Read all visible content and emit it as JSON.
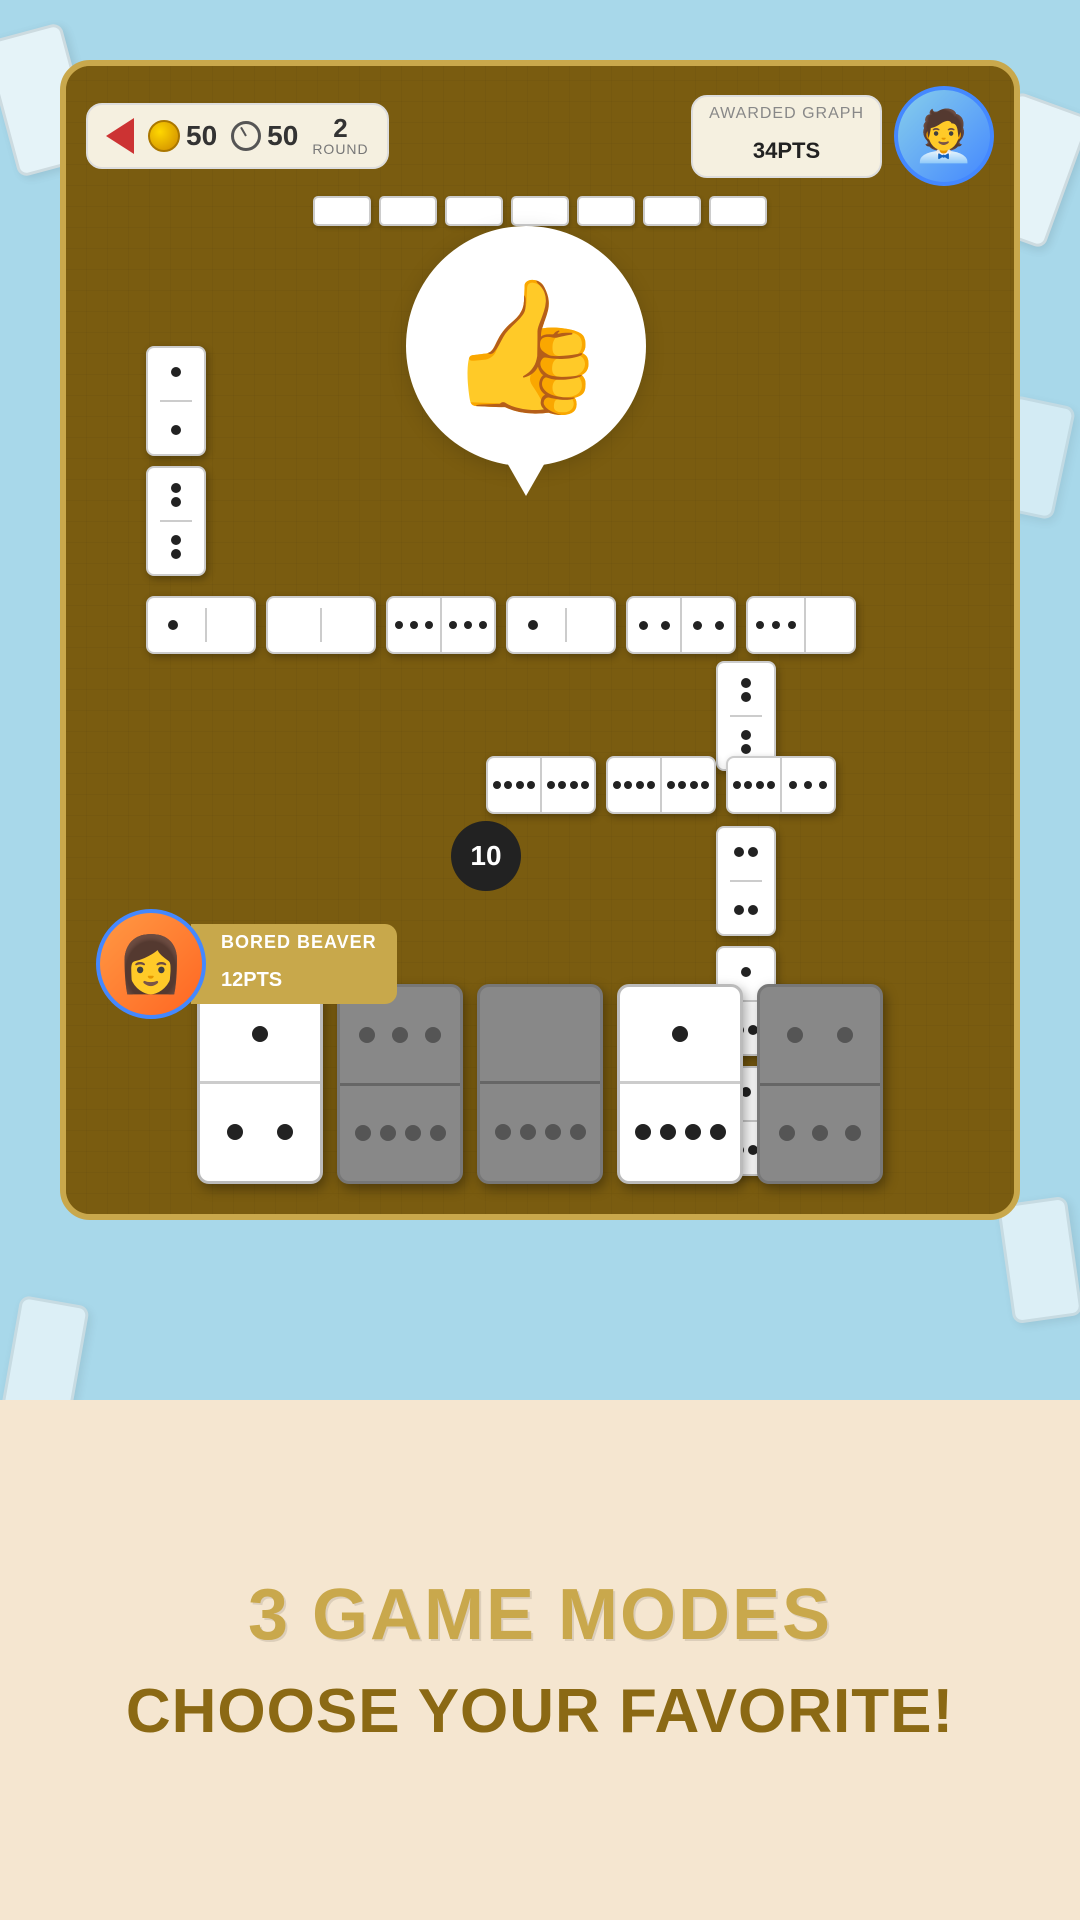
{
  "background": {
    "color": "#a8d8ea"
  },
  "header": {
    "back_button_label": "back",
    "coin_count": "50",
    "timer_count": "50",
    "round_number": "2",
    "round_label": "ROUND",
    "awarded_label": "AWARDED GRAPH",
    "awarded_pts": "34",
    "awarded_pts_suffix": "PTS"
  },
  "opponent": {
    "avatar_emoji": "🧑‍💼",
    "pts": "34"
  },
  "player": {
    "name": "BORED BEAVER",
    "pts": "12",
    "pts_suffix": "PTS",
    "avatar_emoji": "👩"
  },
  "game": {
    "score_bubble": "10",
    "thumbs_up_emoji": "👍"
  },
  "bottom": {
    "headline1": "3 GAME MODES",
    "headline2": "CHOOSE YOUR FAVORITE!"
  },
  "hand_tiles": [
    {
      "type": "white",
      "top_dots": 1,
      "bottom_dots": 2
    },
    {
      "type": "gray",
      "top_dots": 3,
      "bottom_dots": 4
    },
    {
      "type": "gray",
      "top_dots": 0,
      "bottom_dots": 4
    },
    {
      "type": "white",
      "top_dots": 1,
      "bottom_dots": 4
    },
    {
      "type": "gray",
      "top_dots": 2,
      "bottom_dots": 3
    }
  ]
}
